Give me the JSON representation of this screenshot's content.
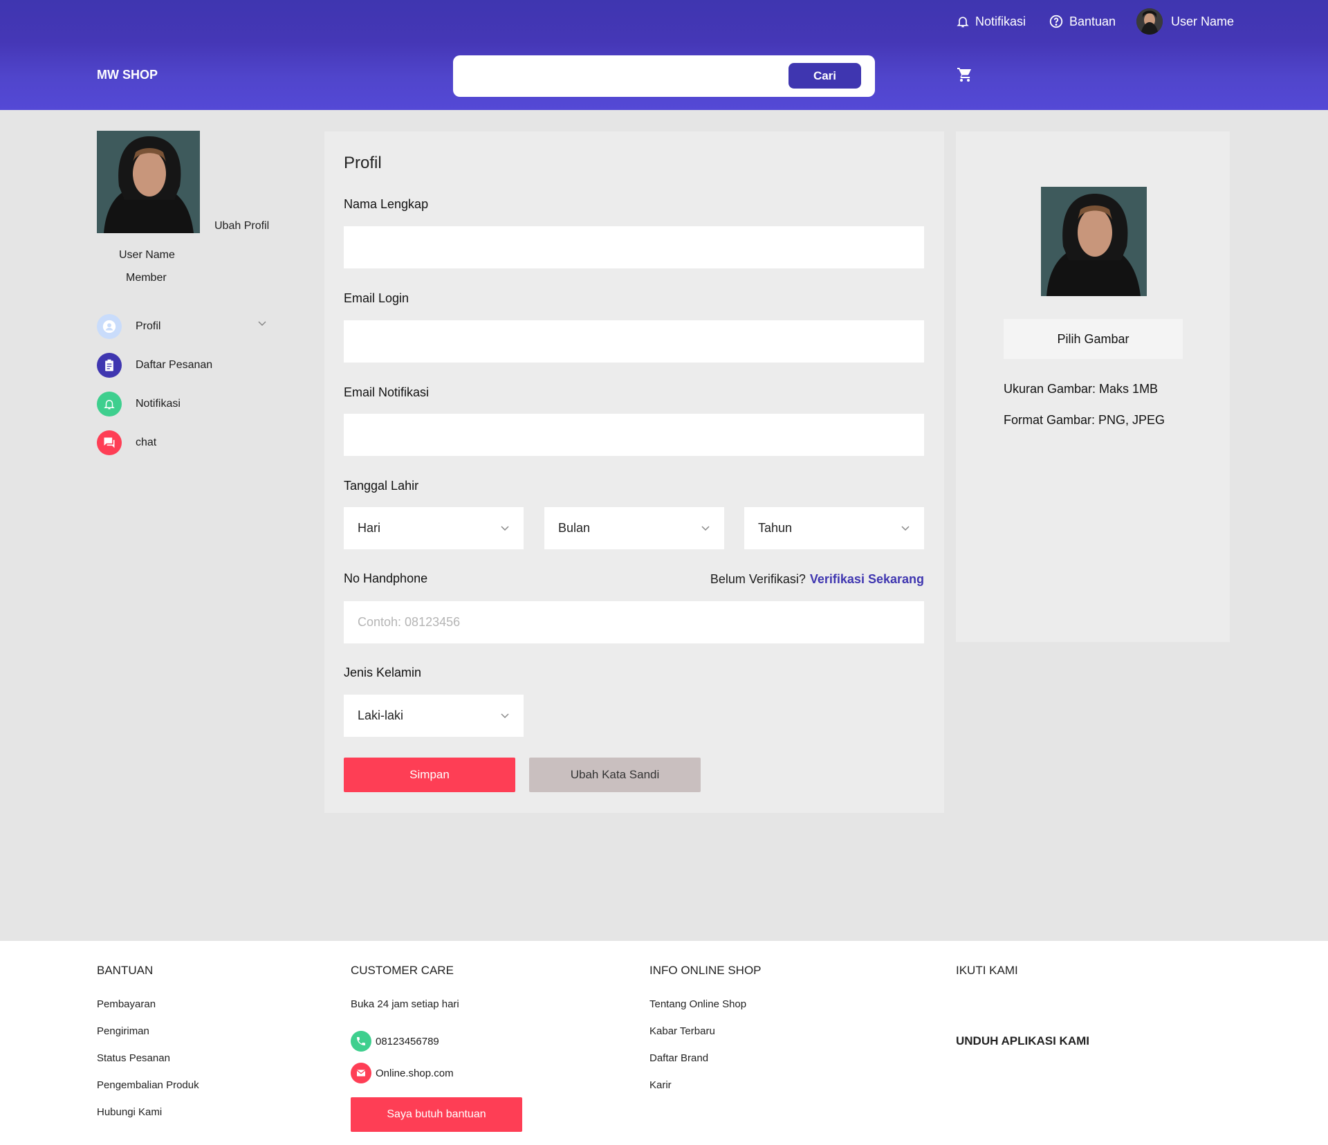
{
  "header": {
    "notifications_label": "Notifikasi",
    "help_label": "Bantuan",
    "user_name": "User Name",
    "brand": "MW SHOP",
    "search_placeholder": "",
    "search_button": "Cari"
  },
  "sidebar": {
    "edit_profile": "Ubah Profil",
    "user_name": "User Name",
    "role": "Member",
    "items": [
      {
        "label": "Profil",
        "icon": "user-icon",
        "color": "#c9dcfb"
      },
      {
        "label": "Daftar Pesanan",
        "icon": "clipboard-icon",
        "color": "#3f36b0"
      },
      {
        "label": "Notifikasi",
        "icon": "bell-icon",
        "color": "#3ecf8e"
      },
      {
        "label": "chat",
        "icon": "chat-icon",
        "color": "#fe3e55"
      }
    ]
  },
  "form": {
    "title": "Profil",
    "full_name_label": "Nama Lengkap",
    "email_login_label": "Email Login",
    "email_notif_label": "Email Notifikasi",
    "birth_label": "Tanggal Lahir",
    "day": "Hari",
    "month": "Bulan",
    "year": "Tahun",
    "phone_label": "No Handphone",
    "verify_prompt": "Belum Verifikasi?",
    "verify_link": "Verifikasi Sekarang",
    "phone_placeholder": "Contoh: 08123456",
    "gender_label": "Jenis Kelamin",
    "gender_value": "Laki-laki",
    "save_button": "Simpan",
    "change_password_button": "Ubah Kata Sandi"
  },
  "photo_panel": {
    "pick_button": "Pilih Gambar",
    "size_info": "Ukuran Gambar: Maks 1MB",
    "format_info": "Format Gambar: PNG, JPEG"
  },
  "footer": {
    "help": {
      "heading": "BANTUAN",
      "links": [
        "Pembayaran",
        "Pengiriman",
        "Status Pesanan",
        "Pengembalian Produk",
        "Hubungi Kami"
      ]
    },
    "customer_care": {
      "heading": "CUSTOMER CARE",
      "hours": "Buka 24 jam setiap hari",
      "phone": "08123456789",
      "email": "Online.shop.com",
      "button": "Saya butuh bantuan"
    },
    "info": {
      "heading": "INFO ONLINE SHOP",
      "links": [
        "Tentang Online Shop",
        "Kabar Terbaru",
        "Daftar Brand",
        "Karir"
      ]
    },
    "follow_heading": "IKUTI KAMI",
    "download_heading": "UNDUH APLIKASI KAMI"
  },
  "colors": {
    "primary": "#3f36b0",
    "accent": "#fe3e55",
    "background": "#e5e5e5"
  }
}
